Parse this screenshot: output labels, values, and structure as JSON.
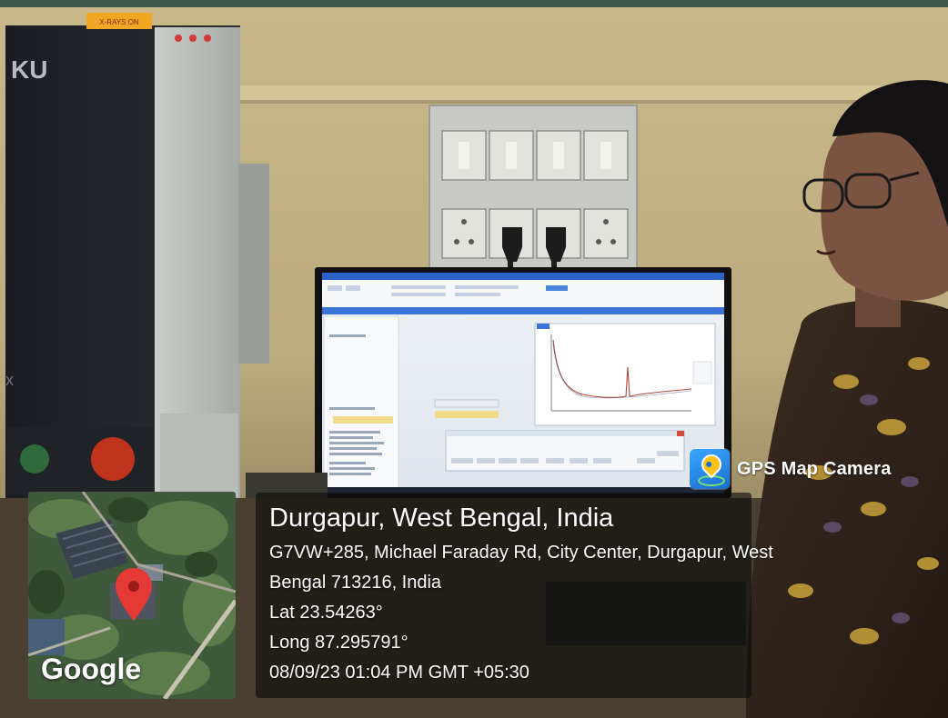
{
  "photo": {
    "warning_label": "X-RAYS ON",
    "instrument_brand_fragment": "KU"
  },
  "gps_badge": {
    "app_name": "GPS Map Camera",
    "icon": "map-pin-camera-icon"
  },
  "location": {
    "place": "Durgapur, West Bengal, India",
    "address_line1": "G7VW+285, Michael Faraday Rd, City Center, Durgapur, West",
    "address_line2": "Bengal 713216, India",
    "lat": "Lat 23.54263°",
    "long": "Long 87.295791°",
    "datetime": "08/09/23 01:04 PM GMT +05:30"
  },
  "map": {
    "provider": "Google",
    "marker_icon": "location-marker-icon",
    "colors": {
      "marker": "#e53935"
    }
  }
}
